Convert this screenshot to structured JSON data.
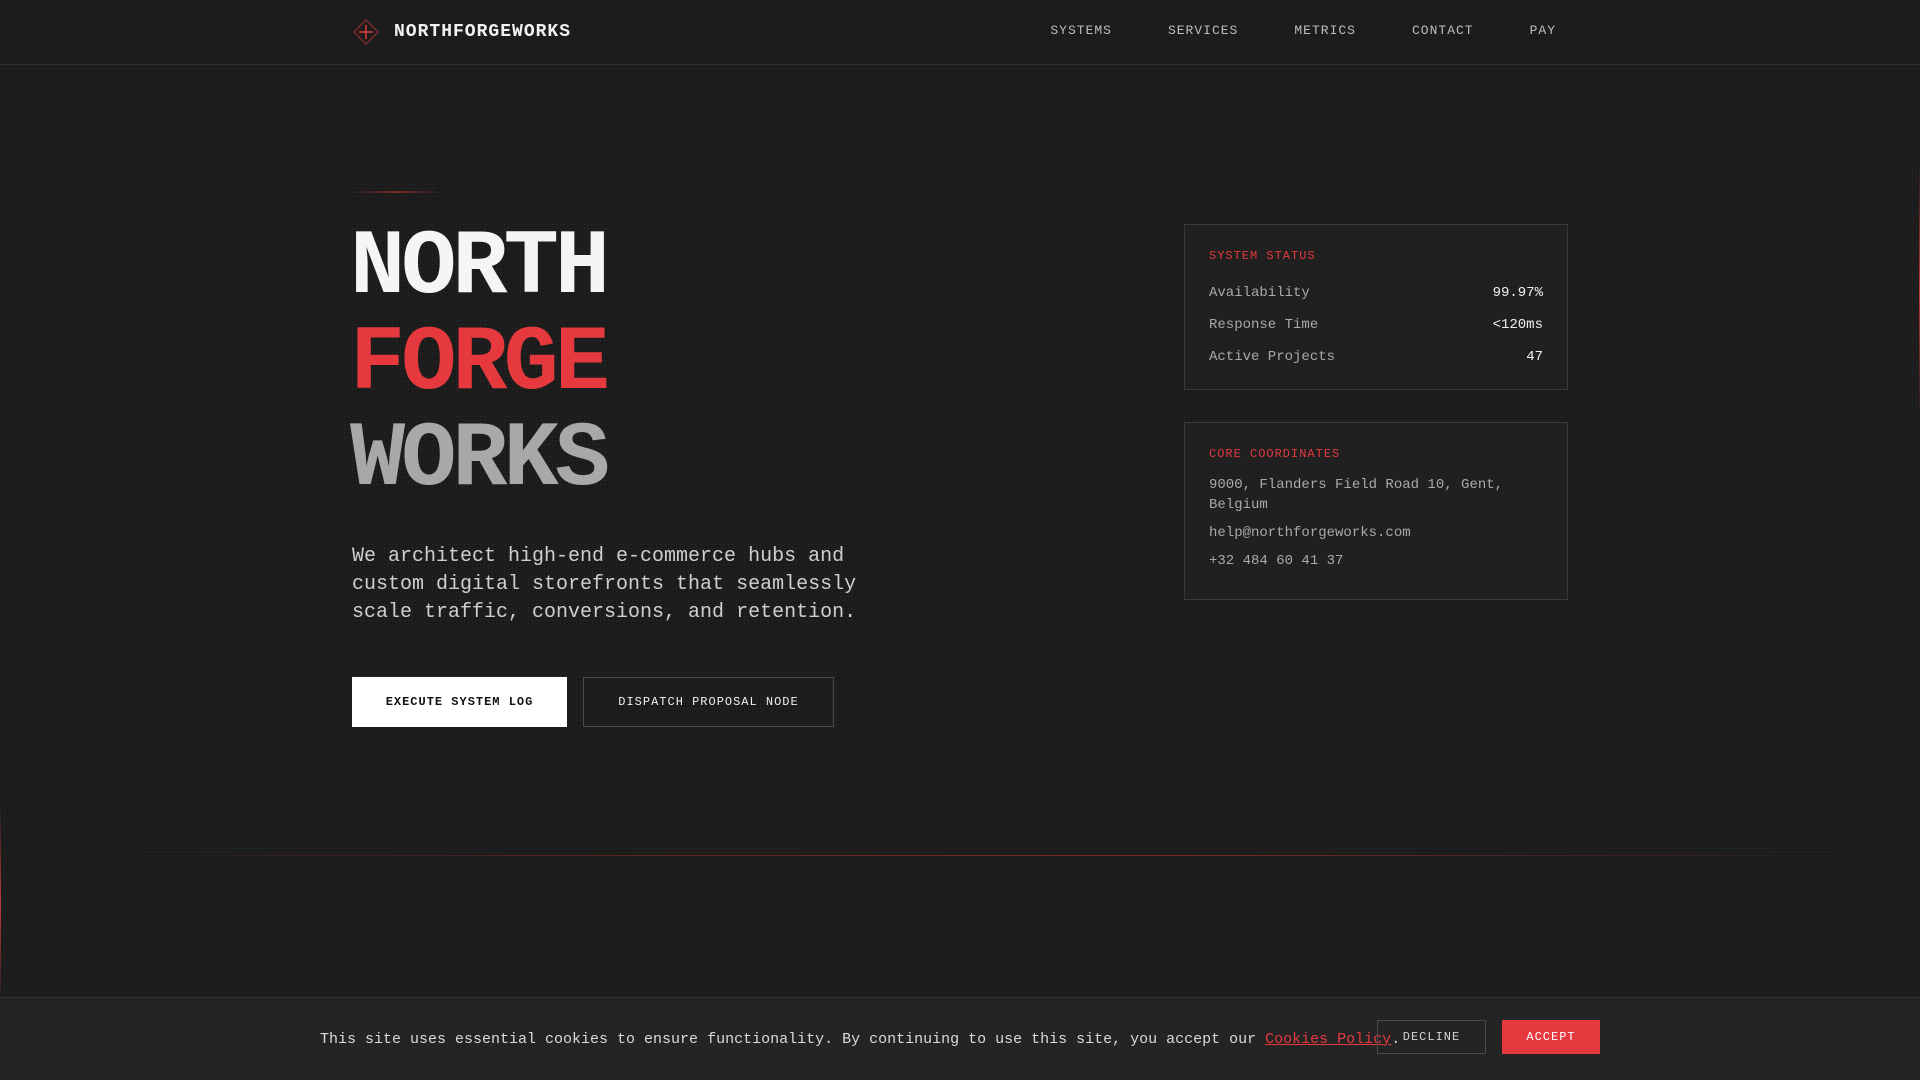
{
  "brand": {
    "name": "NORTHFORGEWORKS",
    "logo_icon": "compass-diamond-icon"
  },
  "nav": {
    "items": [
      "SYSTEMS",
      "SERVICES",
      "METRICS",
      "CONTACT",
      "PAY"
    ]
  },
  "hero": {
    "title_line1": "NORTH",
    "title_line2": "FORGE",
    "title_line3": "WORKS",
    "description": "We architect high-end e-commerce hubs and custom digital storefronts that seamlessly scale traffic, conversions, and retention.",
    "primary_button": "EXECUTE SYSTEM LOG",
    "secondary_button": "DISPATCH PROPOSAL NODE"
  },
  "status_panel": {
    "label": "SYSTEM STATUS",
    "rows": [
      {
        "key": "Availability",
        "value": "99.97%"
      },
      {
        "key": "Response Time",
        "value": "<120ms"
      },
      {
        "key": "Active Projects",
        "value": "47"
      }
    ]
  },
  "coords_panel": {
    "label": "CORE COORDINATES",
    "address": "9000, Flanders Field Road 10, Gent, Belgium",
    "email": "help@northforgeworks.com",
    "phone": "+32 484 60 41 37"
  },
  "cookie": {
    "text_before": "This site uses essential cookies to ensure functionality. By continuing to use this site, you accept our ",
    "link": "Cookies Policy",
    "text_after": ".",
    "decline": "DECLINE",
    "accept": "ACCEPT"
  },
  "colors": {
    "accent": "#e5393e",
    "background": "#1b1b1b",
    "muted_text": "#a9a9a9"
  }
}
